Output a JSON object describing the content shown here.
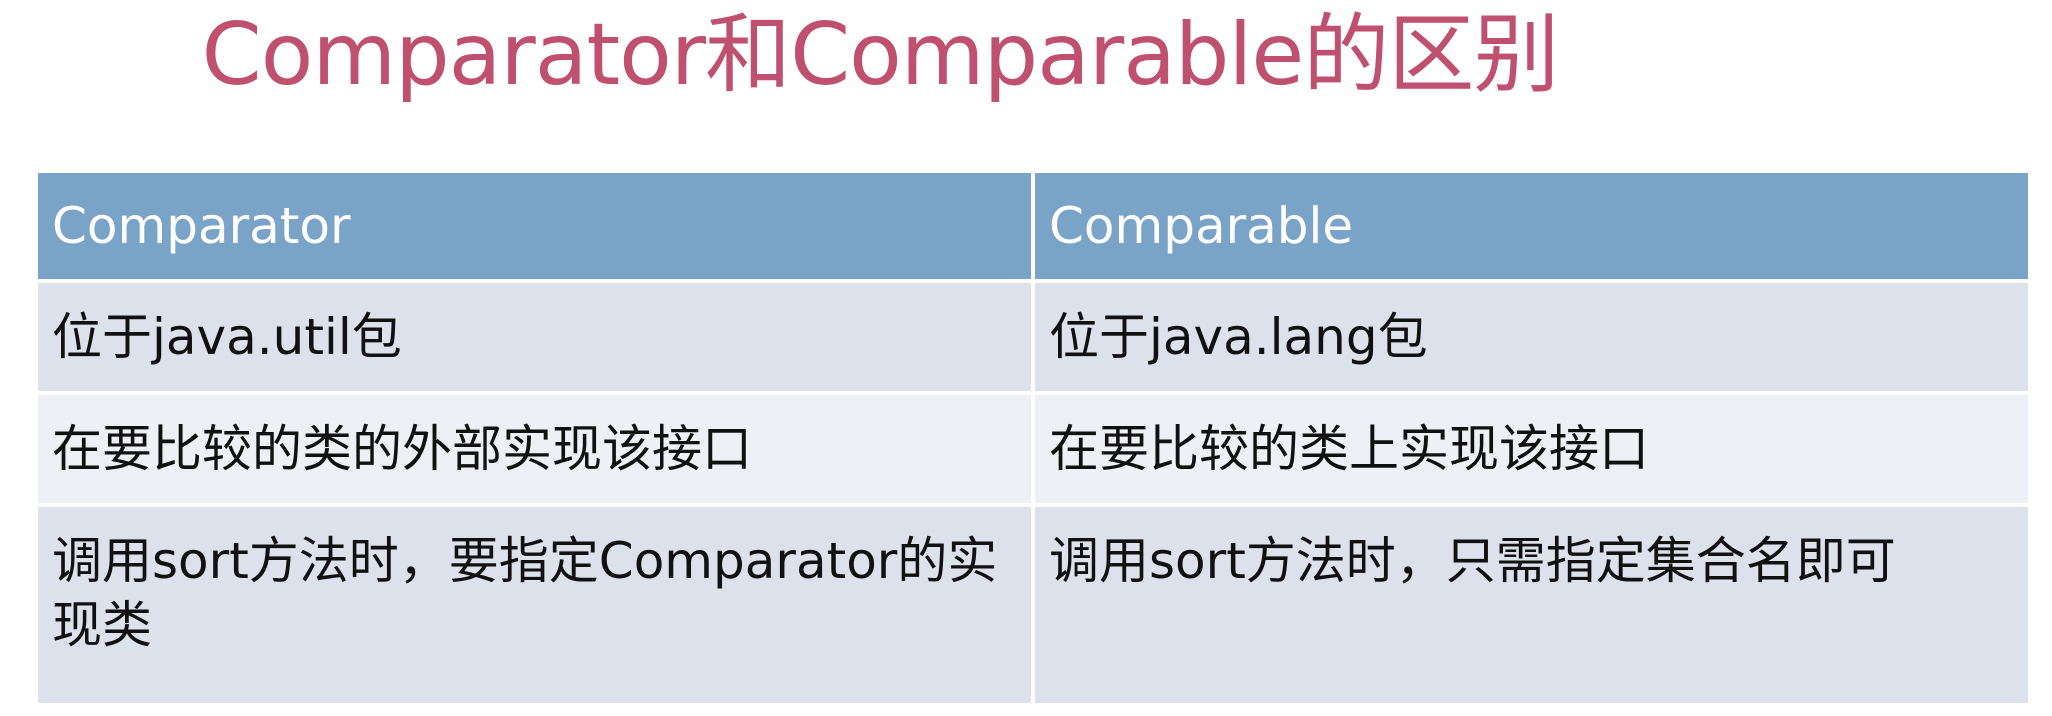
{
  "slide": {
    "title": "Comparator和Comparable的区别"
  },
  "table": {
    "headers": [
      "Comparator",
      "Comparable"
    ],
    "rows": [
      [
        "位于java.util包",
        "位于java.lang包"
      ],
      [
        "在要比较的类的外部实现该接口",
        "在要比较的类上实现该接口"
      ],
      [
        "调用sort方法时，要指定Comparator的实现类",
        "调用sort方法时，只需指定集合名即可"
      ]
    ]
  },
  "colors": {
    "title": "#c0506f",
    "header_bg": "#7aa3c8",
    "row_odd_bg": "#dce1ec",
    "row_even_bg": "#eef0f6"
  }
}
